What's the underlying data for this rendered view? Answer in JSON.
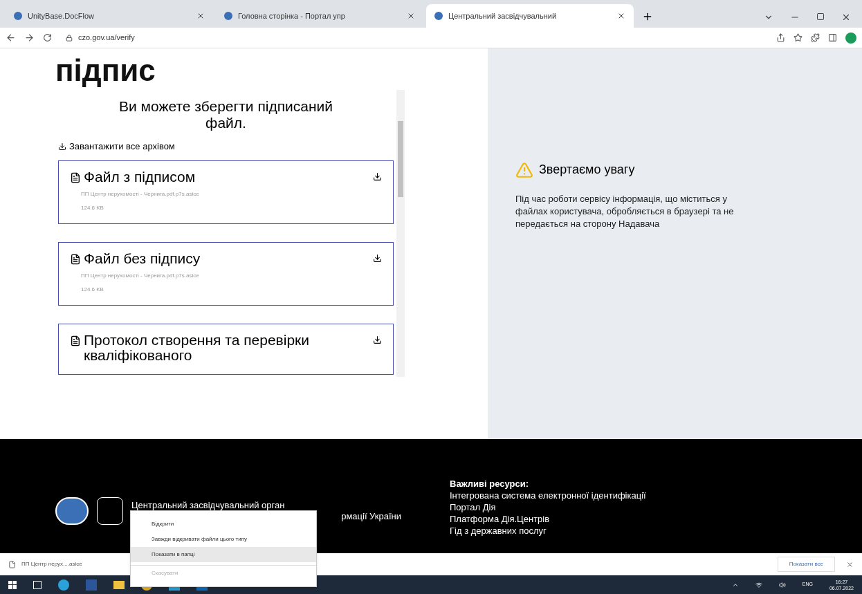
{
  "browser": {
    "tabs": [
      {
        "title": "UnityBase.DocFlow",
        "selected": false
      },
      {
        "title": "Головна сторінка - Портал упр",
        "selected": false
      },
      {
        "title": "Центральний засвідчувальний",
        "selected": true
      }
    ],
    "address": "czo.gov.ua/verify"
  },
  "page": {
    "heading": "підпис",
    "subtitle": "Ви можете зберегти підписаний файл.",
    "download_all": "Завантажити все архівом",
    "files": [
      {
        "title": "Файл з підписом",
        "name": "ПП Центр нерухомості - Чернига.pdf.p7s.asice",
        "size": "124.6 KB"
      },
      {
        "title": "Файл без підпису",
        "name": "ПП Центр нерухомості - Чернига.pdf.p7s.asice",
        "size": "124.6 KB"
      },
      {
        "title": "Протокол створення та перевірки кваліфікованого"
      }
    ],
    "notice": {
      "title": "Звертаємо увагу",
      "text": "Під час роботи сервісу інформація, що міститься у файлах користувача, обробляється в браузері та не передається на сторону Надавача"
    }
  },
  "footer": {
    "org_line_1": "Центральний засвідчувальний орган",
    "org_line_2": "рмації України",
    "resources_title": "Важливі ресурси:",
    "resources": [
      "Інтегрована система електронної ідентифікації",
      "Портал Дія",
      "Платформа Дія.Центрів",
      "Гід з державних послуг"
    ]
  },
  "context_menu": [
    {
      "label": "Відкрити",
      "selected": false,
      "disabled": false
    },
    {
      "label": "Завжди відкривати файли цього типу",
      "selected": false,
      "disabled": false
    },
    {
      "label": "Показати в папці",
      "selected": true,
      "disabled": false
    },
    {
      "label": "Скасувати",
      "selected": false,
      "disabled": true
    }
  ],
  "download_bar": {
    "file": "ПП Центр нерух....asice",
    "show_all": "Показати все"
  },
  "taskbar": {
    "language": "ENG",
    "time": "16:27",
    "date": "06.07.2022"
  }
}
